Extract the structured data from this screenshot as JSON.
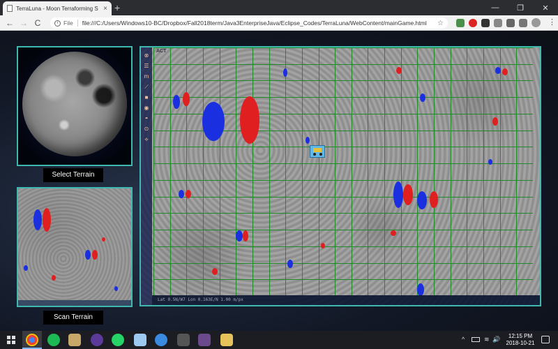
{
  "browser": {
    "tab_title": "TerraLuna - Moon Terraforming S",
    "tab_close": "×",
    "new_tab": "+",
    "file_label": "File",
    "url": "file:///C:/Users/Windows10-BC/Dropbox/Fall2018term/Java3EnterpriseJava/Eclipse_Codes/TerraLuna/WebContent/mainGame.html",
    "back": "←",
    "forward": "→",
    "reload": "C",
    "star": "☆",
    "menu": "⋮",
    "minimize": "—",
    "maximize": "❐",
    "close": "✕"
  },
  "app": {
    "select_terrain_label": "Select Terrain",
    "scan_terrain_label": "Scan Terrain",
    "logo_text": "ACT",
    "status_text": "Lat  0.5N/W7  Lon  0.163E/N         1.00 m/px",
    "tools": [
      "⊗",
      "☰",
      "m",
      "⟋",
      "■",
      "◉",
      "◓",
      "⊙",
      "⟡"
    ],
    "colors": {
      "accent_border": "#3fb8b0",
      "raise_red": "#e02020",
      "lower_blue": "#1a2fe0",
      "grid_green": "#1f8a2a"
    }
  },
  "taskbar": {
    "time": "12:15 PM",
    "date": "2018-10-21",
    "tray_chevron": "^",
    "tray_volume": "🔊"
  }
}
